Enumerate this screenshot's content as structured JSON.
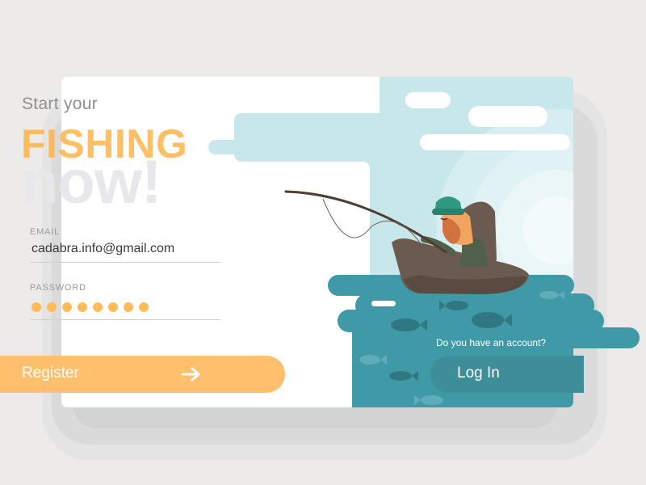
{
  "headline": {
    "intro": "Start your",
    "primary": "FISHING",
    "secondary": "now!"
  },
  "form": {
    "email_label": "EMAIL",
    "email_value": "cadabra.info@gmail.com",
    "password_label": "PASSWORD",
    "password_mask_count": 8,
    "register_label": "Register"
  },
  "login": {
    "prompt": "Do you have an account?",
    "button_label": "Log In"
  },
  "colors": {
    "accent_orange": "#ffbf6c",
    "water_teal": "#4099a6",
    "sky": "#c7e6ea",
    "card_bg": "#ffffff",
    "page_bg": "#ecebea"
  },
  "icons": {
    "register_arrow": "arrow-right-icon"
  }
}
